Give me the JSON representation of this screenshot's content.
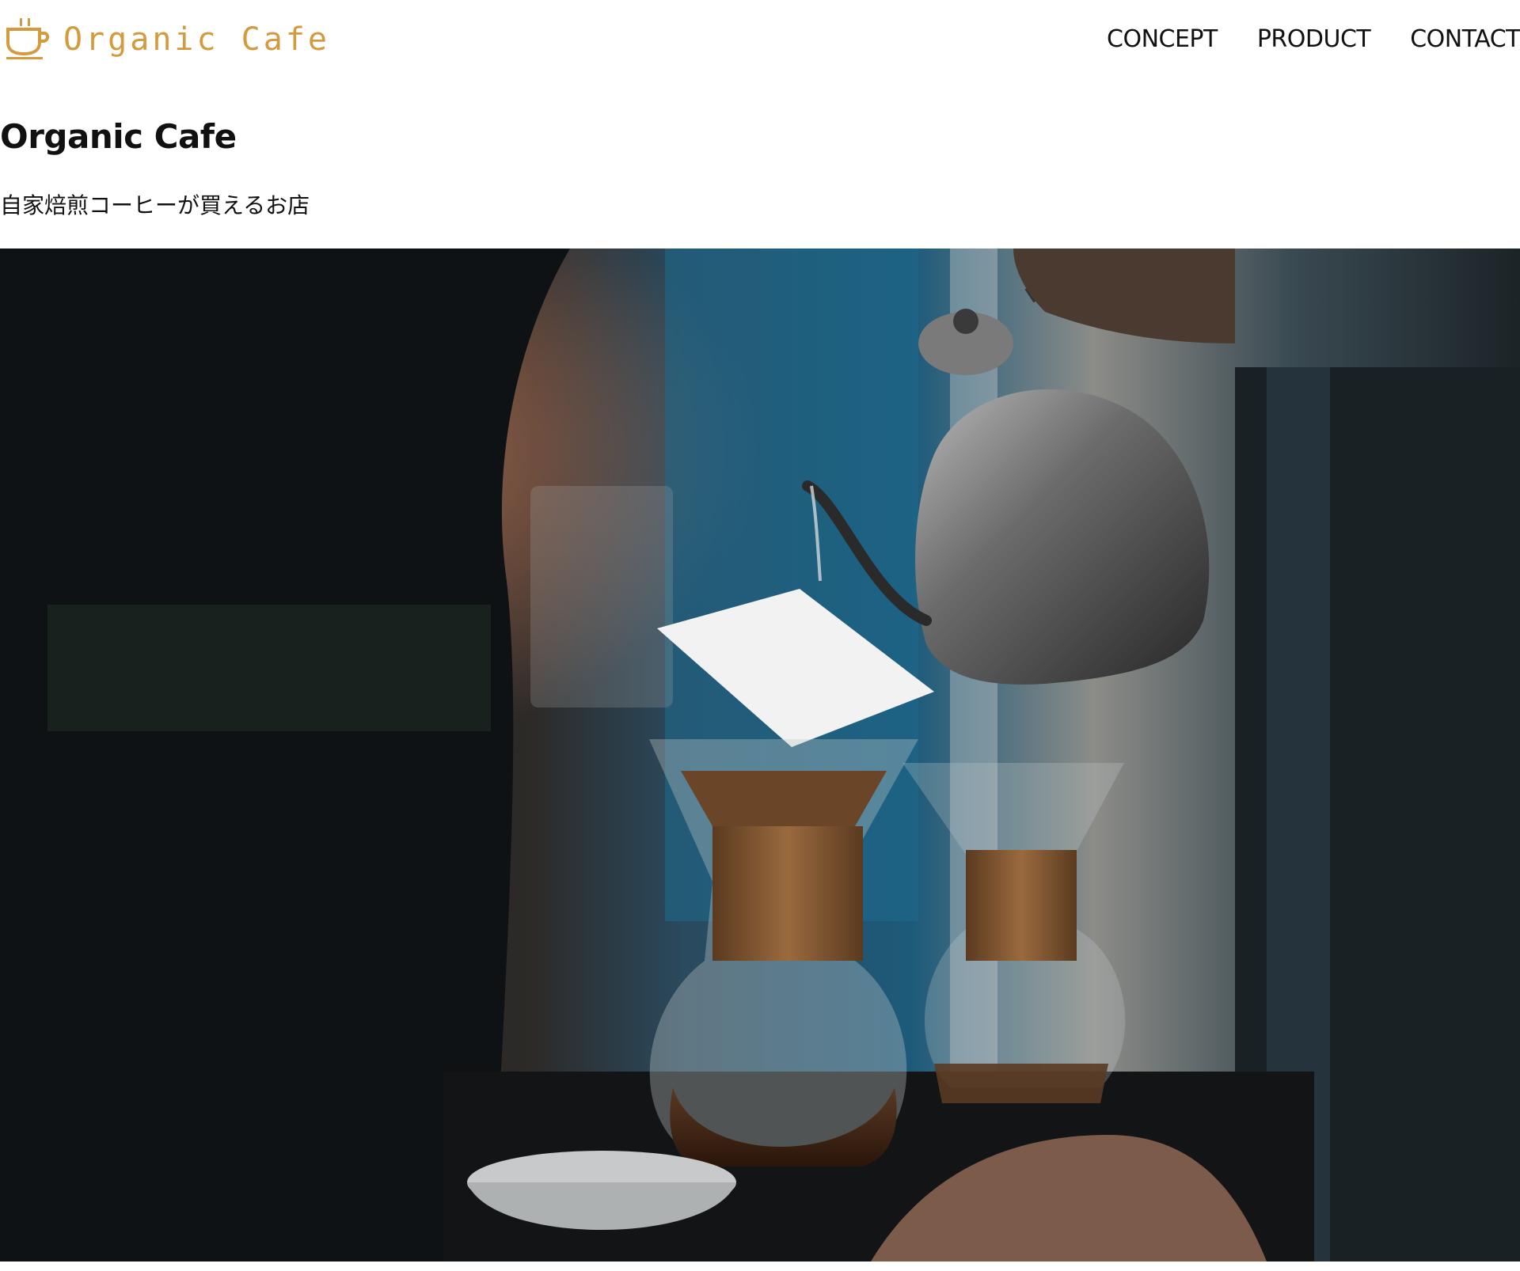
{
  "header": {
    "logo_text": "Organic Cafe",
    "logo_icon": "coffee-cup-icon",
    "brand_color": "#d39a3e",
    "nav": [
      {
        "label": "CONCEPT"
      },
      {
        "label": "PRODUCT"
      },
      {
        "label": "CONTACT"
      }
    ]
  },
  "intro": {
    "title": "Organic Cafe",
    "tagline": "自家焙煎コーヒーが買えるお店"
  }
}
